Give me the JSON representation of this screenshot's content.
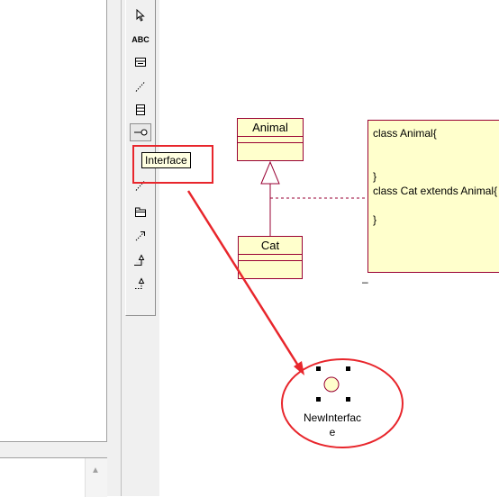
{
  "toolbox": {
    "tools": [
      {
        "id": "pointer",
        "icon": "pointer-arrow-icon"
      },
      {
        "id": "text",
        "icon": "text-abc-icon",
        "label": "ABC"
      },
      {
        "id": "note",
        "icon": "note-icon"
      },
      {
        "id": "anchor",
        "icon": "note-anchor-icon"
      },
      {
        "id": "class",
        "icon": "class-icon"
      },
      {
        "id": "interface",
        "icon": "interface-lollipop-icon"
      },
      {
        "id": "dependency",
        "icon": "dependency-icon"
      },
      {
        "id": "package",
        "icon": "package-icon"
      },
      {
        "id": "association",
        "icon": "directed-association-icon"
      },
      {
        "id": "generalization",
        "icon": "generalization-icon"
      },
      {
        "id": "realization",
        "icon": "realization-icon"
      }
    ],
    "selected": "interface"
  },
  "tooltip": {
    "text": "Interface"
  },
  "diagram": {
    "classes": [
      {
        "id": "animal",
        "name": "Animal"
      },
      {
        "id": "cat",
        "name": "Cat"
      }
    ],
    "note": {
      "lines": [
        "class Animal{",
        "",
        "",
        "}",
        "class Cat extends Animal{",
        "",
        "}"
      ]
    },
    "tick": "–",
    "new_interface": {
      "name_line1": "NewInterfac",
      "name_line2": "e"
    }
  },
  "colors": {
    "uml_fill": "#ffffcc",
    "uml_border": "#990033",
    "annotation_red": "#e8262c",
    "tooltip_bg": "#ffffe1"
  }
}
